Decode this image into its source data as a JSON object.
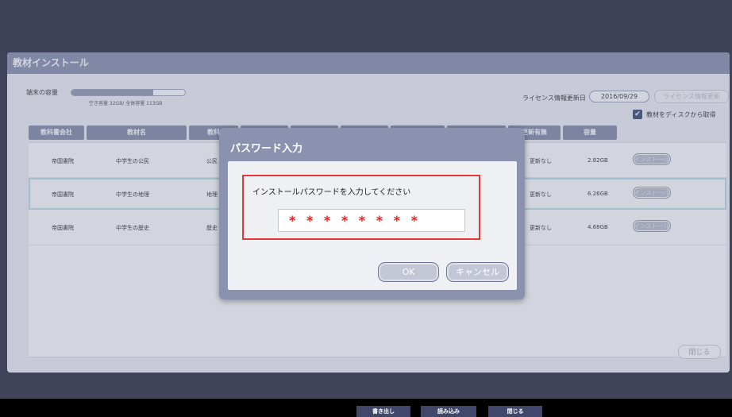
{
  "window": {
    "title": "教材インストール"
  },
  "storage": {
    "label": "端末の容量",
    "free": "空き容量 32GB",
    "total": "全体容量 113GB",
    "text": "空き容量 32GB/ 全体容量 113GB",
    "used_fraction": 0.717
  },
  "license": {
    "updated_label": "ライセンス情報更新日",
    "updated_date": "2016/09/29",
    "update_button": "ライセンス情報更新",
    "checkbox_label": "教材をディスクから取得",
    "checkbox_checked": true
  },
  "table": {
    "headers": [
      "教科書会社",
      "教材名",
      "教科",
      "",
      "",
      "",
      "",
      "更新有無",
      "容量"
    ],
    "rows": [
      {
        "publisher": "帝国書院",
        "name": "中学生の公民",
        "subject": "公民",
        "update": "更新なし",
        "size": "2.82GB",
        "action": "インストール"
      },
      {
        "publisher": "帝国書院",
        "name": "中学生の地理",
        "subject": "地理",
        "update": "更新なし",
        "size": "6.26GB",
        "action": "インストール"
      },
      {
        "publisher": "帝国書院",
        "name": "中学生の歴史",
        "subject": "歴史",
        "update": "更新なし",
        "size": "4.68GB",
        "action": "インストール"
      }
    ],
    "selected_row": 1
  },
  "close_small_label": "閉じる",
  "dialog": {
    "title": "パスワード入力",
    "prompt": "インストールパスワードを入力してください",
    "password_mask": "********",
    "ok_label": "OK",
    "cancel_label": "キャンセル"
  },
  "bottom_toolbar": {
    "export_label": "書き出し",
    "import_label": "読み込み",
    "close_label": "閉じる"
  },
  "colors": {
    "background": "#41435a",
    "title_bar": "#8089a8",
    "header_cell": "#7b83a2",
    "highlight_border": "#e03a3a",
    "password_text": "#e02424"
  }
}
